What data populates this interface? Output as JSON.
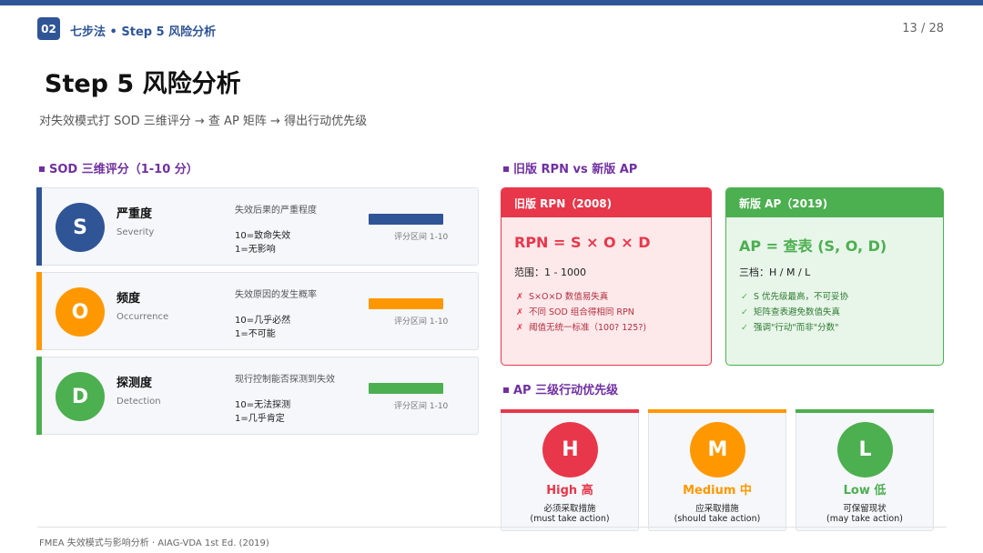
{
  "header": {
    "badge": "02",
    "section": "七步法 • Step 5 风险分析",
    "page": "13 / 28"
  },
  "title": "Step 5 风险分析",
  "subtitle": "对失效模式打 SOD 三维评分 → 查 AP 矩阵 → 得出行动优先级",
  "sod": {
    "heading": "SOD 三维评分（1-10 分）",
    "cards": [
      {
        "letter": "S",
        "name": "严重度",
        "en": "Severity",
        "desc": "失效后果的严重程度",
        "line1": "10=致命失效",
        "line2": "1=无影响",
        "range": "评分区间 1-10",
        "color": "#2f5597"
      },
      {
        "letter": "O",
        "name": "频度",
        "en": "Occurrence",
        "desc": "失效原因的发生概率",
        "line1": "10=几乎必然",
        "line2": "1=不可能",
        "range": "评分区间 1-10",
        "color": "#ff9800"
      },
      {
        "letter": "D",
        "name": "探测度",
        "en": "Detection",
        "desc": "现行控制能否探测到失效",
        "line1": "10=无法探测",
        "line2": "1=几乎肯定",
        "range": "评分区间 1-10",
        "color": "#4caf50"
      }
    ]
  },
  "compare": {
    "heading": "旧版 RPN vs 新版 AP",
    "rpn": {
      "header": "旧版 RPN（2008)",
      "formula": "RPN = S × O × D",
      "range": "范围：1 - 1000",
      "mark": "✗",
      "points": [
        "S×O×D 数值易失真",
        "不同 SOD 组合得相同 RPN",
        "阈值无统一标准（100? 125?)"
      ]
    },
    "ap": {
      "header": "新版 AP（2019)",
      "formula": "AP = 查表 (S, O, D)",
      "range": "三档：H / M / L",
      "mark": "✓",
      "points": [
        "S 优先级最高，不可妥协",
        "矩阵查表避免数值失真",
        "强调\"行动\"而非\"分数\""
      ]
    }
  },
  "ap_levels": {
    "heading": "AP 三级行动优先级",
    "items": [
      {
        "letter": "H",
        "name": "High 高",
        "desc1": "必须采取措施",
        "desc2": "(must take action)",
        "color": "#e8374a"
      },
      {
        "letter": "M",
        "name": "Medium 中",
        "desc1": "应采取措施",
        "desc2": "(should take action)",
        "color": "#ff9800"
      },
      {
        "letter": "L",
        "name": "Low 低",
        "desc1": "可保留现状",
        "desc2": "(may take action)",
        "color": "#4caf50"
      }
    ]
  },
  "footer": "FMEA 失效模式与影响分析 · AIAG-VDA 1st Ed. (2019)"
}
